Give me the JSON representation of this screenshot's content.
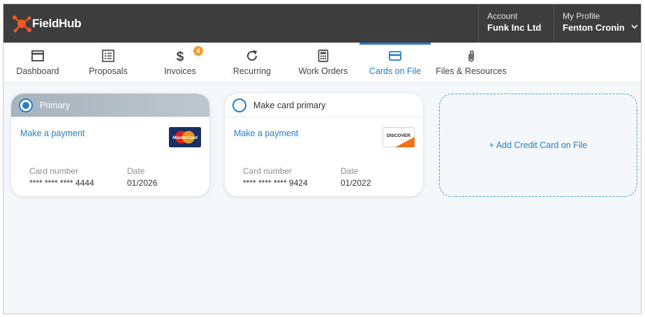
{
  "app": {
    "logo_text": "FieldHub"
  },
  "header": {
    "account_label": "Account",
    "account_value": "Funk Inc Ltd",
    "profile_label": "My Profile",
    "profile_value": "Fenton Cronin"
  },
  "nav": {
    "tabs": [
      {
        "label": "Dashboard",
        "icon": "window-icon"
      },
      {
        "label": "Proposals",
        "icon": "list-icon"
      },
      {
        "label": "Invoices",
        "icon": "dollar-icon",
        "badge": "4"
      },
      {
        "label": "Recurring",
        "icon": "refresh-icon"
      },
      {
        "label": "Work Orders",
        "icon": "calculator-icon"
      },
      {
        "label": "Cards on File",
        "icon": "credit-card-icon",
        "active": true
      },
      {
        "label": "Files & Resources",
        "icon": "paperclip-icon"
      }
    ]
  },
  "cards": [
    {
      "header_label": "Primary",
      "primary": true,
      "pay_link": "Make a payment",
      "brand": "MasterCard",
      "card_number_label": "Card number",
      "card_number": "**** **** **** 4444",
      "date_label": "Date",
      "date": "01/2026"
    },
    {
      "header_label": "Make card primary",
      "primary": false,
      "pay_link": "Make a payment",
      "brand": "DISCOVER",
      "card_number_label": "Card number",
      "card_number": "**** **** **** 9424",
      "date_label": "Date",
      "date": "01/2022"
    }
  ],
  "add_card_label": "+ Add Credit Card on File",
  "colors": {
    "accent": "#2a7dc6",
    "topbar": "#3d3d3d",
    "badge": "#f0a030",
    "logo": "#f05a22"
  }
}
